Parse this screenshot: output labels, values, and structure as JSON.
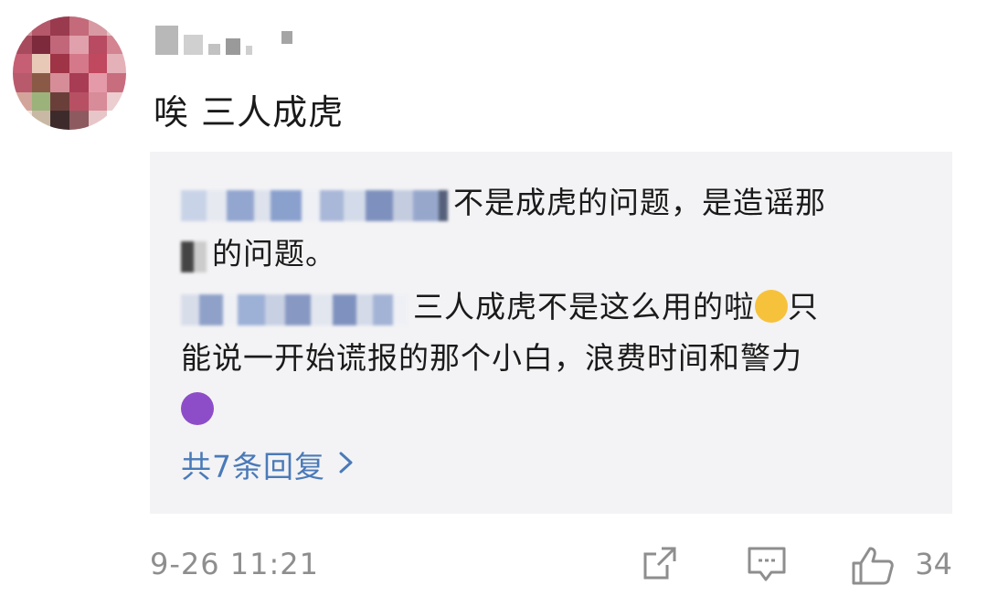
{
  "comment": {
    "text": "唉 三人成虎"
  },
  "replies": [
    {
      "text_line1": "不是成虎的问题，是造谣那",
      "text_line2": "的问题。"
    },
    {
      "text_a": "三人成虎不是这么用的啦",
      "emoji_a": "mask-face",
      "text_b": "只",
      "text_line2": "能说一开始谎报的那个小白，浪费时间和警力",
      "emoji_b": "smiling-devil"
    }
  ],
  "more_replies": {
    "label": "共7条回复",
    "icon": "chevron-right-icon"
  },
  "footer": {
    "timestamp": "9-26 11:21",
    "share_icon": "share-icon",
    "comment_icon": "comment-icon",
    "like_icon": "thumbs-up-icon",
    "like_count": "34"
  },
  "colors": {
    "link": "#4a7ab8",
    "muted": "#8e8e8e",
    "reply_bg": "#f3f3f5"
  }
}
